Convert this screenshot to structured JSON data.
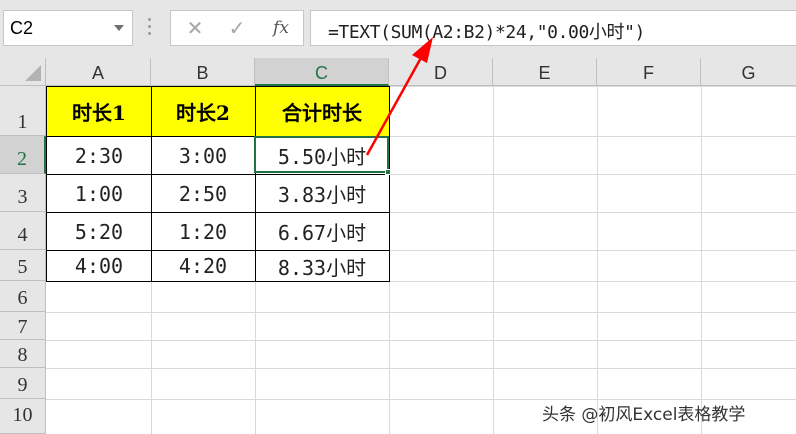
{
  "name_box": {
    "value": "C2"
  },
  "formula_bar": {
    "cancel_glyph": "✕",
    "enter_glyph": "✓",
    "fx_label": "fx",
    "formula": "=TEXT(SUM(A2:B2)*24,\"0.00小时\")"
  },
  "columns": [
    "A",
    "B",
    "C",
    "D",
    "E",
    "F",
    "G"
  ],
  "selected_column": "C",
  "rows": [
    "1",
    "2",
    "3",
    "4",
    "5",
    "6",
    "7",
    "8",
    "9",
    "10"
  ],
  "selected_row": "2",
  "table": {
    "headers": [
      "时长1",
      "时长2",
      "合计时长"
    ],
    "header_fill": "#ffff00",
    "rows": [
      [
        "2:30",
        "3:00",
        "5.50小时"
      ],
      [
        "1:00",
        "2:50",
        "3.83小时"
      ],
      [
        "5:20",
        "1:20",
        "6.67小时"
      ],
      [
        "4:00",
        "4:20",
        "8.33小时"
      ]
    ]
  },
  "active_cell": "C2",
  "annotation": {
    "type": "arrow",
    "color": "#ff0000",
    "from_cell": "C2",
    "to": "formula-bar"
  },
  "watermark": "头条 @初风Excel表格教学",
  "colors": {
    "accent": "#217346",
    "header_bg": "#e6e6e6",
    "selected_header_bg": "#d2d2d2",
    "gridline": "#d9d9d9"
  }
}
